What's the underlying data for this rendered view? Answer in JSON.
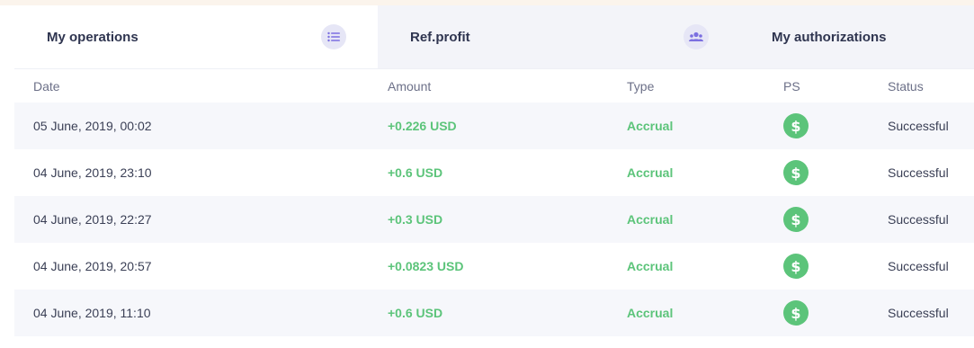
{
  "tabs": [
    {
      "label": "My operations",
      "icon": "list-icon"
    },
    {
      "label": "Ref.profit",
      "icon": "users-icon"
    },
    {
      "label": "My authorizations"
    }
  ],
  "table": {
    "headers": {
      "date": "Date",
      "amount": "Amount",
      "type": "Type",
      "ps": "PS",
      "status": "Status"
    },
    "rows": [
      {
        "date": "05 June, 2019, 00:02",
        "amount": "+0.226 USD",
        "type": "Accrual",
        "ps": "dollar-icon",
        "status": "Successful"
      },
      {
        "date": "04 June, 2019, 23:10",
        "amount": "+0.6 USD",
        "type": "Accrual",
        "ps": "dollar-icon",
        "status": "Successful"
      },
      {
        "date": "04 June, 2019, 22:27",
        "amount": "+0.3 USD",
        "type": "Accrual",
        "ps": "dollar-icon",
        "status": "Successful"
      },
      {
        "date": "04 June, 2019, 20:57",
        "amount": "+0.0823 USD",
        "type": "Accrual",
        "ps": "dollar-icon",
        "status": "Successful"
      },
      {
        "date": "04 June, 2019, 11:10",
        "amount": "+0.6 USD",
        "type": "Accrual",
        "ps": "dollar-icon",
        "status": "Successful"
      }
    ]
  },
  "colors": {
    "accent_green": "#5cc47a",
    "accent_purple": "#7b6fe0",
    "tab_inactive_bg": "#f3f4f9"
  }
}
